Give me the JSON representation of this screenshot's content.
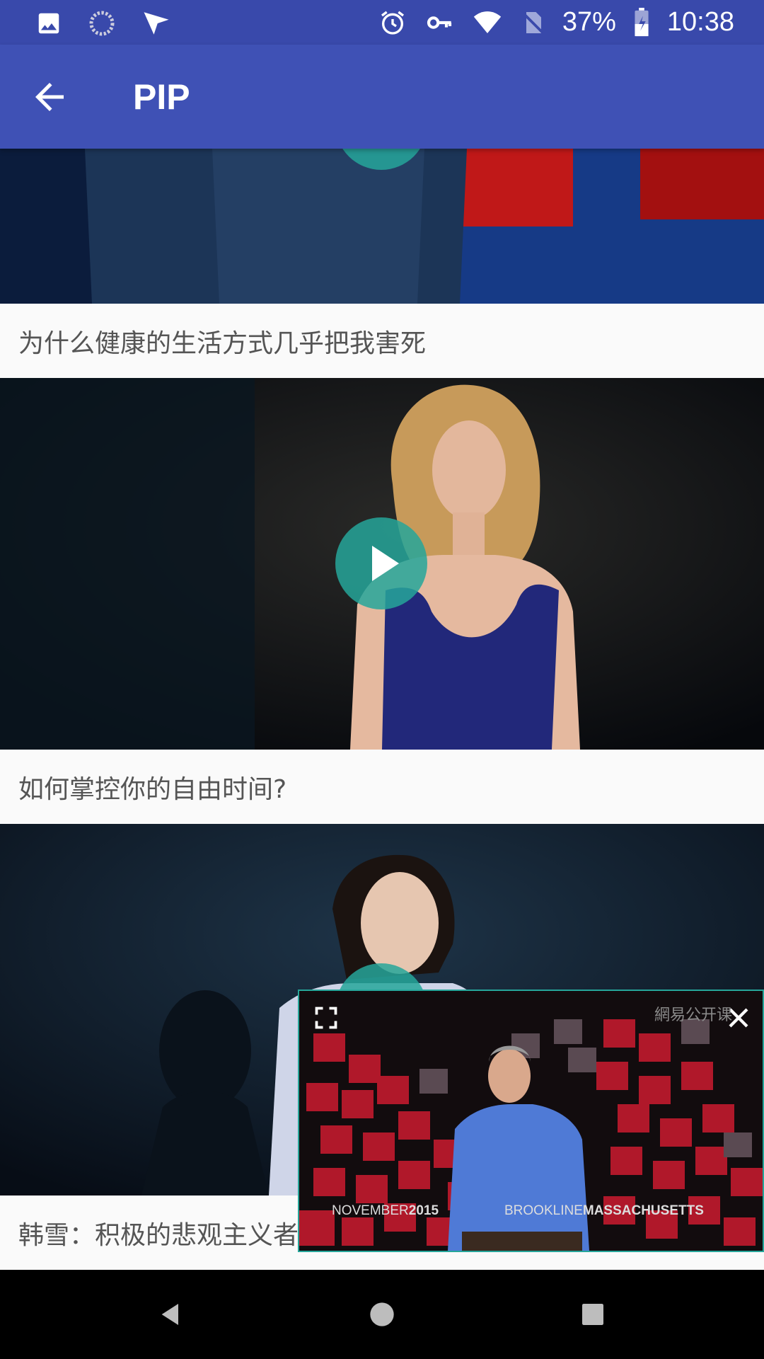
{
  "status_bar": {
    "battery": "37%",
    "time": "10:38",
    "icons": [
      "image-icon",
      "sync-icon",
      "send-icon",
      "alarm-icon",
      "vpn-key-icon",
      "wifi-icon",
      "no-sim-icon",
      "battery-charging-icon"
    ]
  },
  "app_bar": {
    "back_icon": "arrow-back-icon",
    "title": "PIP"
  },
  "videos": [
    {
      "title": "为什么健康的生活方式几乎把我害死"
    },
    {
      "title": "如何掌控你的自由时间?"
    },
    {
      "title": "韩雪：积极的悲观主义者"
    }
  ],
  "pip": {
    "date_prefix": "NOVEMBER",
    "date_year": "2015",
    "location_city": "BROOKLINE",
    "location_state": "MASSACHUSETTS",
    "watermark": "網易公开课",
    "fullscreen_icon": "fullscreen-icon",
    "close_icon": "close-icon"
  },
  "nav_bar": {
    "back": "nav-back-icon",
    "home": "nav-home-icon",
    "recents": "nav-recents-icon"
  },
  "colors": {
    "status_bar": "#3949ab",
    "app_bar": "#3f51b5",
    "accent": "#26a69a",
    "caption_text": "#555555"
  }
}
